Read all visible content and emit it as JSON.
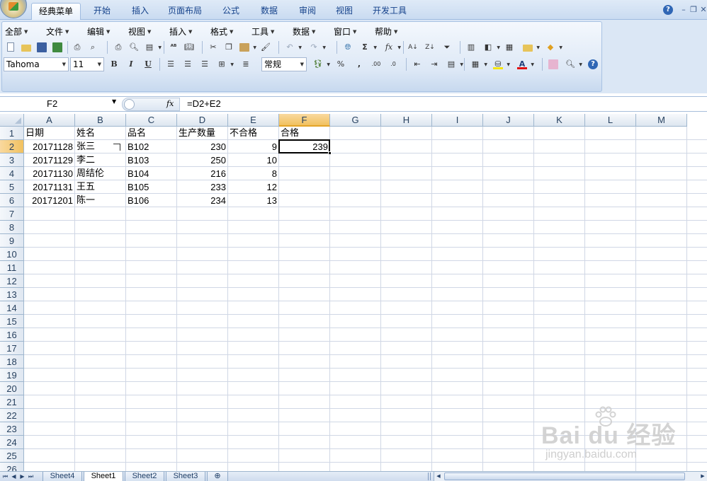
{
  "ribbon_tabs": [
    {
      "label": "经典菜单",
      "active": true
    },
    {
      "label": "开始"
    },
    {
      "label": "插入"
    },
    {
      "label": "页面布局"
    },
    {
      "label": "公式"
    },
    {
      "label": "数据"
    },
    {
      "label": "审阅"
    },
    {
      "label": "视图"
    },
    {
      "label": "开发工具"
    }
  ],
  "menu": [
    "全部",
    "文件",
    "编辑",
    "视图",
    "插入",
    "格式",
    "工具",
    "数据",
    "窗口",
    "帮助"
  ],
  "toolbar": {
    "font_name": "Tahoma",
    "font_size": "11",
    "number_format": "常规",
    "bold_label": "B",
    "italic_label": "I",
    "underline_label": "U",
    "percent_label": "%",
    "comma_label": ",",
    "sum_label": "Σ",
    "fx_label": "fx"
  },
  "formula_bar": {
    "name_box": "F2",
    "fx_label": "fx",
    "formula": "=D2+E2"
  },
  "grid": {
    "columns": [
      "A",
      "B",
      "C",
      "D",
      "E",
      "F",
      "G",
      "H",
      "I",
      "J",
      "K",
      "L",
      "M"
    ],
    "selected_column": "F",
    "rows": [
      "1",
      "2",
      "3",
      "4",
      "5",
      "6",
      "7",
      "8",
      "9",
      "10",
      "11",
      "12",
      "13",
      "14",
      "15",
      "16",
      "17",
      "18",
      "19",
      "20",
      "21",
      "22",
      "23",
      "24",
      "25",
      "26"
    ],
    "selected_row": "2",
    "header": [
      "日期",
      "姓名",
      "品名",
      "生产数量",
      "不合格",
      "合格"
    ],
    "data": [
      {
        "date": "20171128",
        "name": "张三",
        "product": "B102",
        "qty": "230",
        "defect": "9",
        "pass": "239"
      },
      {
        "date": "20171129",
        "name": "李二",
        "product": "B103",
        "qty": "250",
        "defect": "10",
        "pass": ""
      },
      {
        "date": "20171130",
        "name": "周结伦",
        "product": "B104",
        "qty": "216",
        "defect": "8",
        "pass": ""
      },
      {
        "date": "20171131",
        "name": "王五",
        "product": "B105",
        "qty": "233",
        "defect": "12",
        "pass": ""
      },
      {
        "date": "20171201",
        "name": "陈一",
        "product": "B106",
        "qty": "234",
        "defect": "13",
        "pass": ""
      }
    ]
  },
  "sheets": [
    {
      "label": "Sheet4"
    },
    {
      "label": "Sheet1",
      "active": true
    },
    {
      "label": "Sheet2"
    },
    {
      "label": "Sheet3"
    }
  ],
  "watermark": {
    "main": "Bai du 经验",
    "sub": "jingyan.baidu.com"
  },
  "colors": {
    "selection_header": "#f1c15f",
    "grid_line": "#d0d7e5",
    "ribbon": "#dbe7f5"
  }
}
